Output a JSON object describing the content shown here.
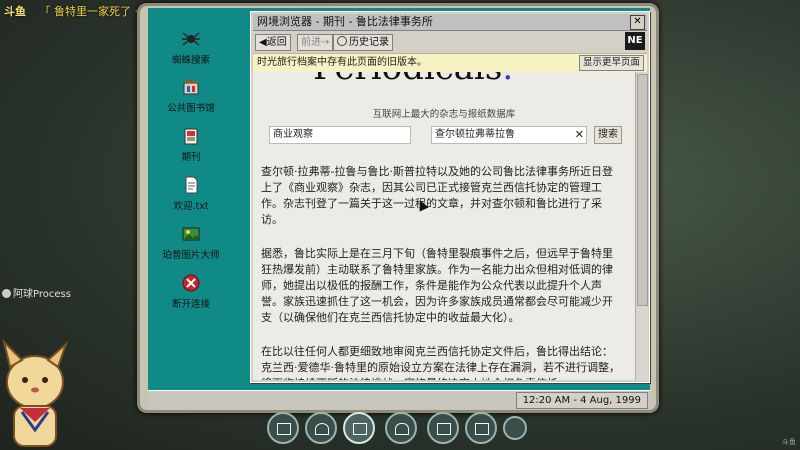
{
  "stream": {
    "logo": "斗鱼",
    "title": "「 鲁特里一家死了 · 狂热 」 - Steam"
  },
  "desktop": {
    "icons": [
      {
        "name": "spider-search",
        "label": "蜘蛛搜索"
      },
      {
        "name": "public-library",
        "label": "公共图书馆"
      },
      {
        "name": "periodicals",
        "label": "期刊"
      },
      {
        "name": "welcome-txt",
        "label": "欢迎.txt"
      },
      {
        "name": "image-master",
        "label": "珀普图片大师"
      },
      {
        "name": "disconnect",
        "label": "断开连接"
      }
    ]
  },
  "window": {
    "title": "网境浏览器 - 期刊 - 鲁比法律事务所",
    "close": "✕",
    "toolbar": {
      "back": "◀返回",
      "forward": "前进→",
      "history": "历史记录"
    },
    "brand": "NE",
    "notice": {
      "text": "时光旅行档案中存有此页面的旧版本。",
      "button": "显示更早页面"
    }
  },
  "page": {
    "masthead": "Periodicals",
    "masthead_dot": ".",
    "tagline": "互联网上最大的杂志与报纸数据库",
    "search": {
      "field1": "商业观察",
      "field2": "查尔顿拉弗蒂拉鲁",
      "clear": "✕",
      "button": "搜索"
    },
    "paragraphs": [
      "查尔顿·拉弗蒂-拉鲁与鲁比·斯普拉特以及她的公司鲁比法律事务所近日登上了《商业观察》杂志，因其公司已正式接管克兰西信托协定的管理工作。杂志刊登了一篇关于这一过程的文章，并对查尔顿和鲁比进行了采访。",
      "据悉，鲁比实际上是在三月下旬（鲁特里裂痕事件之后，但远早于鲁特里狂热爆发前）主动联系了鲁特里家族。作为一名能力出众但相对低调的律师，她提出以极低的报酬工作，条件是能作为公众代表以此提升个人声誉。家族迅速抓住了这一机会，因为许多家族成员通常都会尽可能减少开支（以确保他们在克兰西信托协定中的收益最大化）。",
      "在比以往任何人都更细致地审阅克兰西信托协定文件后，鲁比得出结论：克兰西·爱德华·鲁特里的原始设立方案在法律上存在漏洞，若不进行调整，将面临持续不断的法律挑战。家族最终决定由她全权负责信托"
    ]
  },
  "taskbar": {
    "clock": "12:20 AM - 4 Aug, 1999"
  },
  "overlay": {
    "streamer_name": "阿球Process",
    "watermark": "斗鱼"
  },
  "colors": {
    "desktop": "#0f8a86",
    "notice_bg": "#f6f2c4",
    "accent_dot": "#2b3fbf"
  }
}
